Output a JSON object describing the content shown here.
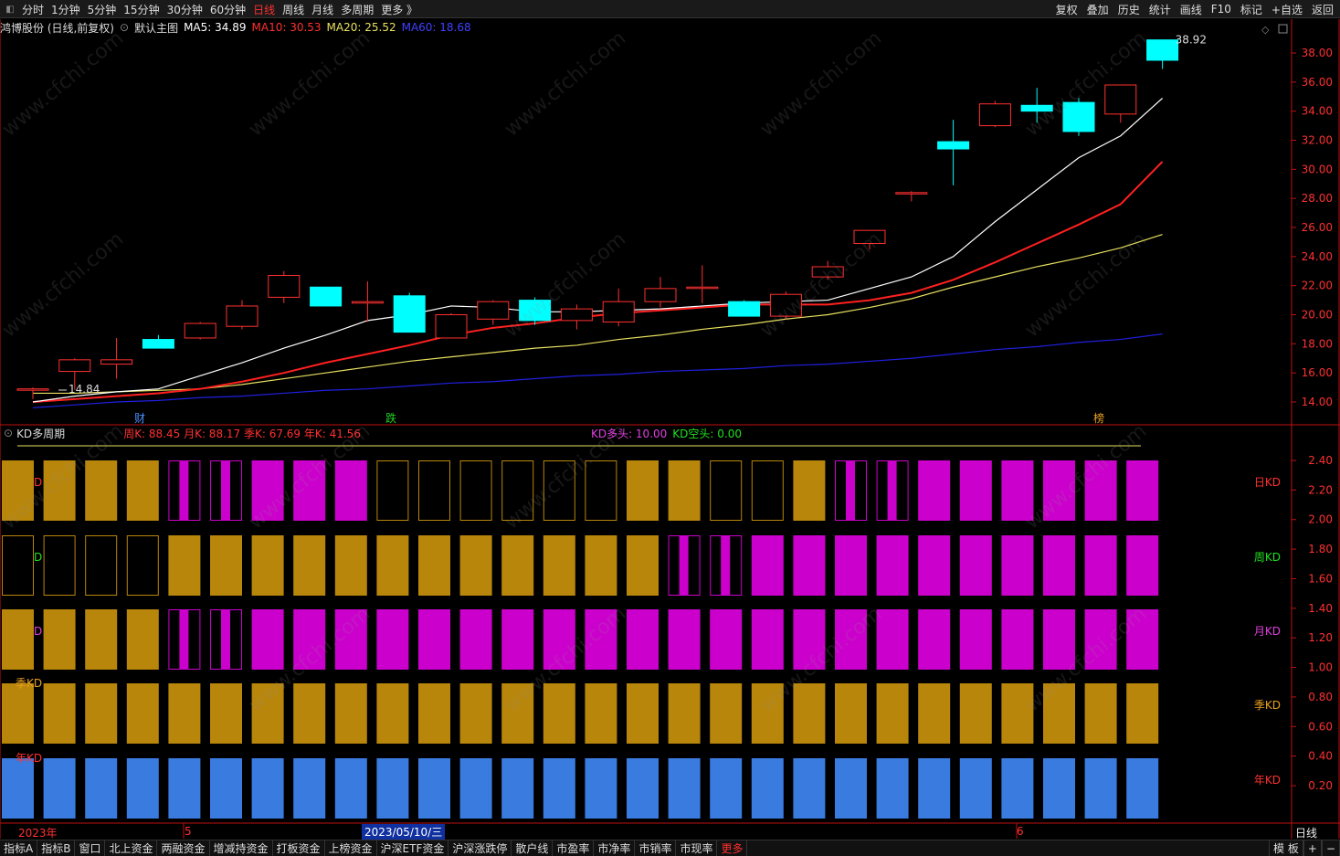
{
  "toolbar": {
    "periods": [
      "分时",
      "1分钟",
      "5分钟",
      "15分钟",
      "30分钟",
      "60分钟",
      "日线",
      "周线",
      "月线",
      "多周期",
      "更多 》"
    ],
    "active_period": "日线",
    "right_items": [
      "复权",
      "叠加",
      "历史",
      "统计",
      "画线",
      "F10",
      "标记",
      "+自选",
      "返回"
    ]
  },
  "main_header": {
    "stock": "鸿博股份 (日线,前复权)",
    "template": "默认主图",
    "ma5": "MA5: 34.89",
    "ma10": "MA10: 30.53",
    "ma20": "MA20: 25.52",
    "ma60": "MA60: 18.68"
  },
  "kd_header": {
    "title": "KD多周期",
    "values": "周K: 88.45  月K: 88.17  季K: 67.69  年K: 41.56",
    "bull": "KD多头: 10.00",
    "bear": "KD空头: 0.00"
  },
  "price_axis": [
    "38.00",
    "36.00",
    "34.00",
    "32.00",
    "30.00",
    "28.00",
    "26.00",
    "24.00",
    "22.00",
    "20.00",
    "18.00",
    "16.00",
    "14.00"
  ],
  "kd_axis": [
    "2.40",
    "2.20",
    "2.00",
    "1.80",
    "1.60",
    "1.40",
    "1.20",
    "1.00",
    "0.80",
    "0.60",
    "0.40",
    "0.20"
  ],
  "annotations": {
    "high": "38.92",
    "low": "14.84",
    "markers": [
      "财",
      "跌",
      "榜"
    ]
  },
  "kd_row_labels": [
    "日KD",
    "周KD",
    "月KD",
    "季KD",
    "年KD"
  ],
  "kd_row_left": [
    "D",
    "D",
    "D",
    "季KD",
    "年KD"
  ],
  "date_axis": {
    "labels": [
      "2023年",
      "5",
      "6"
    ],
    "cursor": "2023/05/10/三"
  },
  "period_label": "日线",
  "bottom_bar": {
    "items": [
      "指标A",
      "指标B",
      "窗口",
      "北上资金",
      "两融资金",
      "增减持资金",
      "打板资金",
      "上榜资金",
      "沪深ETF资金",
      "沪深涨跌停",
      "散户线",
      "市盈率",
      "市净率",
      "市销率",
      "市现率",
      "更多"
    ],
    "right": [
      "模 板",
      "+",
      "−"
    ]
  },
  "watermark": "www.cfchi.com",
  "colors": {
    "up": "#ff3030",
    "down": "#00ffff",
    "ma5": "#ffffff",
    "ma10": "#ff2020",
    "ma20": "#e8e060",
    "ma60": "#2020e0",
    "kd_gold": "#b8860b",
    "kd_magenta": "#cc00cc",
    "kd_blue": "#3a7be0"
  },
  "chart_data": {
    "type": "candlestick",
    "candles": [
      {
        "o": 14.9,
        "h": 15.0,
        "l": 14.2,
        "c": 14.9
      },
      {
        "o": 16.1,
        "h": 17.0,
        "l": 14.84,
        "c": 16.9
      },
      {
        "o": 16.6,
        "h": 18.4,
        "l": 15.6,
        "c": 16.9
      },
      {
        "o": 18.3,
        "h": 18.6,
        "l": 17.7,
        "c": 17.7
      },
      {
        "o": 18.4,
        "h": 19.5,
        "l": 18.3,
        "c": 19.4
      },
      {
        "o": 19.2,
        "h": 21.0,
        "l": 19.0,
        "c": 20.6
      },
      {
        "o": 21.2,
        "h": 23.0,
        "l": 20.8,
        "c": 22.7
      },
      {
        "o": 21.9,
        "h": 21.9,
        "l": 20.6,
        "c": 20.6
      },
      {
        "o": 20.8,
        "h": 22.3,
        "l": 19.5,
        "c": 20.9
      },
      {
        "o": 21.3,
        "h": 21.5,
        "l": 18.8,
        "c": 18.8
      },
      {
        "o": 18.4,
        "h": 20.1,
        "l": 18.4,
        "c": 20.0
      },
      {
        "o": 19.7,
        "h": 21.0,
        "l": 19.3,
        "c": 20.9
      },
      {
        "o": 21.0,
        "h": 21.2,
        "l": 19.3,
        "c": 19.6
      },
      {
        "o": 19.6,
        "h": 20.7,
        "l": 19.0,
        "c": 20.4
      },
      {
        "o": 19.5,
        "h": 21.8,
        "l": 19.2,
        "c": 20.9
      },
      {
        "o": 20.9,
        "h": 22.6,
        "l": 20.5,
        "c": 21.8
      },
      {
        "o": 21.9,
        "h": 23.4,
        "l": 20.8,
        "c": 21.9
      },
      {
        "o": 20.9,
        "h": 21.0,
        "l": 19.9,
        "c": 19.9
      },
      {
        "o": 19.9,
        "h": 21.6,
        "l": 19.7,
        "c": 21.4
      },
      {
        "o": 22.6,
        "h": 23.7,
        "l": 22.4,
        "c": 23.3
      },
      {
        "o": 24.9,
        "h": 25.8,
        "l": 24.5,
        "c": 25.8
      },
      {
        "o": 28.4,
        "h": 28.5,
        "l": 27.8,
        "c": 28.4
      },
      {
        "o": 31.9,
        "h": 33.4,
        "l": 28.9,
        "c": 31.4
      },
      {
        "o": 33.0,
        "h": 34.7,
        "l": 32.9,
        "c": 34.5
      },
      {
        "o": 34.4,
        "h": 35.6,
        "l": 33.2,
        "c": 34.0
      },
      {
        "o": 34.6,
        "h": 34.9,
        "l": 32.3,
        "c": 32.6
      },
      {
        "o": 33.8,
        "h": 35.8,
        "l": 33.2,
        "c": 35.8
      },
      {
        "o": 38.9,
        "h": 38.92,
        "l": 36.9,
        "c": 37.5
      }
    ],
    "ma5": [
      14.0,
      14.4,
      14.7,
      14.9,
      15.8,
      16.7,
      17.7,
      18.6,
      19.6,
      20.0,
      20.6,
      20.5,
      20.2,
      20.2,
      20.3,
      20.4,
      20.6,
      20.8,
      20.9,
      21.0,
      21.8,
      22.6,
      24.0,
      26.4,
      28.6,
      30.8,
      32.3,
      34.89
    ],
    "ma10": [
      14.0,
      14.2,
      14.4,
      14.6,
      14.9,
      15.4,
      16.0,
      16.7,
      17.3,
      17.9,
      18.6,
      19.1,
      19.4,
      19.8,
      20.1,
      20.3,
      20.5,
      20.7,
      20.7,
      20.7,
      21.0,
      21.5,
      22.4,
      23.6,
      24.9,
      26.2,
      27.6,
      30.53
    ],
    "ma20": [
      14.6,
      14.6,
      14.7,
      14.8,
      14.9,
      15.2,
      15.6,
      16.0,
      16.4,
      16.8,
      17.1,
      17.4,
      17.7,
      17.9,
      18.3,
      18.6,
      19.0,
      19.3,
      19.7,
      20.0,
      20.5,
      21.1,
      21.9,
      22.6,
      23.3,
      23.9,
      24.6,
      25.52
    ],
    "ma60": [
      13.6,
      13.8,
      14.0,
      14.1,
      14.3,
      14.4,
      14.6,
      14.8,
      14.9,
      15.1,
      15.3,
      15.4,
      15.6,
      15.8,
      15.9,
      16.1,
      16.2,
      16.3,
      16.5,
      16.6,
      16.8,
      17.0,
      17.3,
      17.6,
      17.8,
      18.1,
      18.3,
      18.68
    ],
    "kd_rows": [
      [
        "G",
        "G",
        "G",
        "G",
        "MO",
        "MO",
        "M",
        "M",
        "M",
        "O",
        "O",
        "O",
        "O",
        "O",
        "O",
        "G",
        "G",
        "O",
        "O",
        "G",
        "MO",
        "MO",
        "M",
        "M",
        "M",
        "M",
        "M",
        "M"
      ],
      [
        "O",
        "O",
        "O",
        "O",
        "G",
        "G",
        "G",
        "G",
        "G",
        "G",
        "G",
        "G",
        "G",
        "G",
        "G",
        "G",
        "MO",
        "MO",
        "M",
        "M",
        "M",
        "M",
        "M",
        "M",
        "M",
        "M",
        "M",
        "M"
      ],
      [
        "G",
        "G",
        "G",
        "G",
        "MO",
        "MO",
        "M",
        "M",
        "M",
        "M",
        "M",
        "M",
        "M",
        "M",
        "M",
        "M",
        "M",
        "M",
        "M",
        "M",
        "M",
        "M",
        "M",
        "M",
        "M",
        "M",
        "M",
        "M"
      ],
      [
        "G",
        "G",
        "G",
        "G",
        "G",
        "G",
        "G",
        "G",
        "G",
        "G",
        "G",
        "G",
        "G",
        "G",
        "G",
        "G",
        "G",
        "G",
        "G",
        "G",
        "G",
        "G",
        "G",
        "G",
        "G",
        "G",
        "G",
        "G"
      ],
      [
        "B",
        "B",
        "B",
        "B",
        "B",
        "B",
        "B",
        "B",
        "B",
        "B",
        "B",
        "B",
        "B",
        "B",
        "B",
        "B",
        "B",
        "B",
        "B",
        "B",
        "B",
        "B",
        "B",
        "B",
        "B",
        "B",
        "B",
        "B"
      ]
    ]
  }
}
